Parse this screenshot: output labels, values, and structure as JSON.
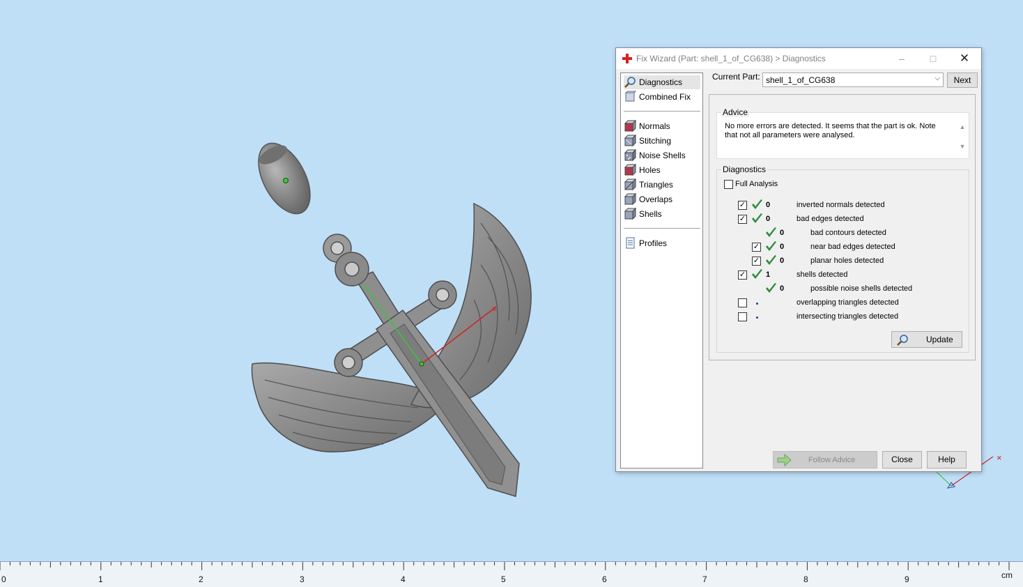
{
  "dialog": {
    "title": "Fix Wizard (Part: shell_1_of_CG638) > Diagnostics",
    "nav": [
      {
        "label": "Diagnostics",
        "icon": "magnifier-icon"
      },
      {
        "label": "Combined Fix",
        "icon": "combined-fix-icon"
      },
      {
        "label": "Normals",
        "icon": "normals-cube-icon"
      },
      {
        "label": "Stitching",
        "icon": "stitching-cube-icon"
      },
      {
        "label": "Noise Shells",
        "icon": "noise-shells-cube-icon"
      },
      {
        "label": "Holes",
        "icon": "holes-cube-icon"
      },
      {
        "label": "Triangles",
        "icon": "triangles-cube-icon"
      },
      {
        "label": "Overlaps",
        "icon": "overlaps-cube-icon"
      },
      {
        "label": "Shells",
        "icon": "shells-cube-icon"
      },
      {
        "label": "Profiles",
        "icon": "profiles-document-icon"
      }
    ],
    "current_part_label": "Current Part:",
    "current_part_value": "shell_1_of_CG638",
    "next_label": "Next",
    "advice": {
      "title": "Advice",
      "text": "No more errors are detected. It seems that the part is ok. Note that not all parameters were analysed."
    },
    "diagnostics": {
      "title": "Diagnostics",
      "full_analysis_label": "Full Analysis",
      "full_analysis_checked": false,
      "rows": [
        {
          "checked": true,
          "status": "ok",
          "count": "0",
          "label": "inverted normals detected",
          "indent": 0,
          "has_checkbox": true
        },
        {
          "checked": true,
          "status": "ok",
          "count": "0",
          "label": "bad edges detected",
          "indent": 0,
          "has_checkbox": true
        },
        {
          "checked": false,
          "status": "ok",
          "count": "0",
          "label": "bad contours detected",
          "indent": 1,
          "has_checkbox": false
        },
        {
          "checked": true,
          "status": "ok",
          "count": "0",
          "label": "near bad edges detected",
          "indent": 1,
          "has_checkbox": true
        },
        {
          "checked": true,
          "status": "ok",
          "count": "0",
          "label": "planar holes detected",
          "indent": 1,
          "has_checkbox": true
        },
        {
          "checked": true,
          "status": "ok",
          "count": "1",
          "label": "shells detected",
          "indent": 0,
          "has_checkbox": true
        },
        {
          "checked": false,
          "status": "ok",
          "count": "0",
          "label": "possible noise shells detected",
          "indent": 1,
          "has_checkbox": false
        },
        {
          "checked": false,
          "status": "pending",
          "count": "",
          "label": "overlapping triangles detected",
          "indent": 0,
          "has_checkbox": true
        },
        {
          "checked": false,
          "status": "pending",
          "count": "",
          "label": "intersecting triangles detected",
          "indent": 0,
          "has_checkbox": true
        }
      ],
      "update_label": "Update"
    },
    "follow_advice_label": "Follow Advice",
    "close_label": "Close",
    "help_label": "Help"
  },
  "ruler": {
    "labels": [
      "0",
      "1",
      "2",
      "3",
      "4",
      "5",
      "6",
      "7",
      "8",
      "9"
    ],
    "unit": "cm"
  },
  "colors": {
    "viewport_bg": "#bfdff7",
    "ok_check": "#2e8b3a",
    "model_gray": "#8c8c8c"
  }
}
